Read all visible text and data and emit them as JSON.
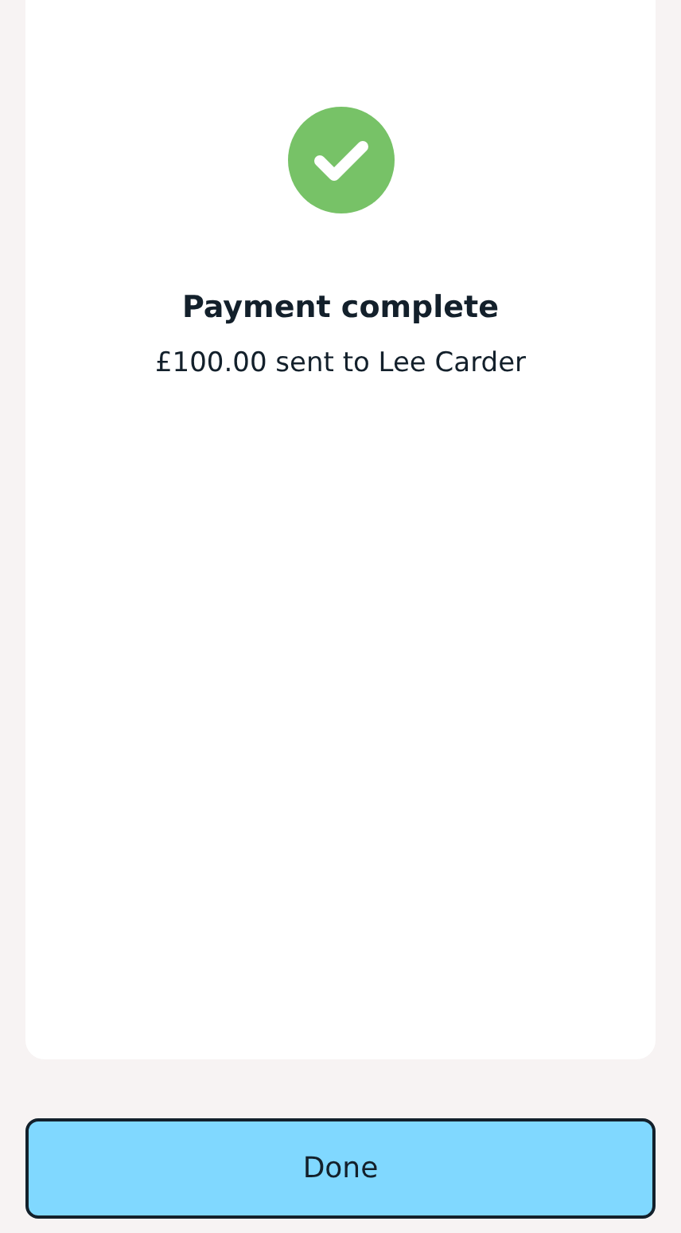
{
  "confirmation": {
    "title": "Payment complete",
    "message": "£100.00 sent to Lee Carder"
  },
  "done_button": {
    "label": "Done"
  }
}
